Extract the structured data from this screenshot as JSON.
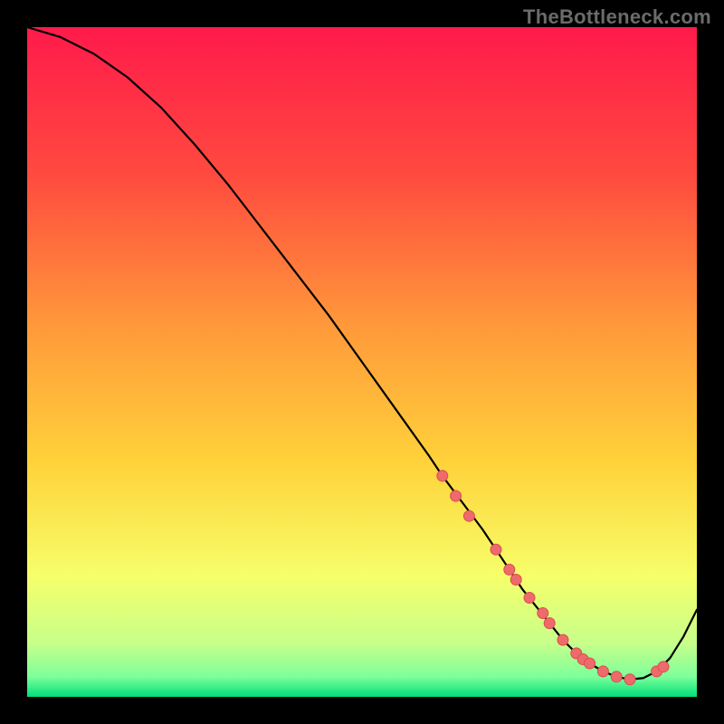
{
  "watermark": "TheBottleneck.com",
  "colors": {
    "gradient_top": "#ff1a4b",
    "gradient_upper_mid": "#ff7a3a",
    "gradient_mid": "#ffd23a",
    "gradient_lower_mid": "#f6ff6a",
    "gradient_low": "#c7ff8a",
    "gradient_bottom": "#00e07a",
    "curve": "#000000",
    "marker_fill": "#ef6a6a",
    "marker_stroke": "#d94f4f",
    "border": "#000000"
  },
  "chart_data": {
    "type": "line",
    "title": "",
    "xlabel": "",
    "ylabel": "",
    "xlim": [
      0,
      100
    ],
    "ylim": [
      0,
      100
    ],
    "grid": false,
    "legend": false,
    "series": [
      {
        "name": "curve",
        "x": [
          0,
          5,
          10,
          15,
          20,
          25,
          30,
          35,
          40,
          45,
          50,
          55,
          60,
          62,
          65,
          68,
          70,
          72,
          74,
          76,
          78,
          80,
          82,
          84,
          86,
          88,
          90,
          92,
          94,
          96,
          98,
          100
        ],
        "y": [
          100,
          98.5,
          96,
          92.5,
          88,
          82.5,
          76.5,
          70,
          63.5,
          57,
          50,
          43,
          36,
          33,
          29,
          25,
          22,
          19,
          16,
          13.5,
          11,
          8.5,
          6.5,
          5,
          3.8,
          3,
          2.6,
          2.8,
          3.8,
          5.8,
          9,
          13
        ]
      }
    ],
    "markers": {
      "name": "highlight-points",
      "x": [
        62,
        64,
        66,
        70,
        72,
        73,
        75,
        77,
        78,
        80,
        82,
        83,
        84,
        86,
        88,
        90,
        94,
        95
      ],
      "y": [
        33,
        30,
        27,
        22,
        19,
        17.5,
        14.8,
        12.5,
        11,
        8.5,
        6.5,
        5.6,
        5,
        3.8,
        3,
        2.6,
        3.8,
        4.5
      ]
    },
    "background_bands_y": [
      {
        "from": 100,
        "to": 55,
        "approx_color": "#ff1a4b"
      },
      {
        "from": 55,
        "to": 30,
        "approx_color": "#ff9a3a"
      },
      {
        "from": 30,
        "to": 12,
        "approx_color": "#ffe33a"
      },
      {
        "from": 12,
        "to": 5,
        "approx_color": "#f6ff6a"
      },
      {
        "from": 5,
        "to": 2,
        "approx_color": "#c7ff8a"
      },
      {
        "from": 2,
        "to": 0,
        "approx_color": "#00e07a"
      }
    ]
  }
}
